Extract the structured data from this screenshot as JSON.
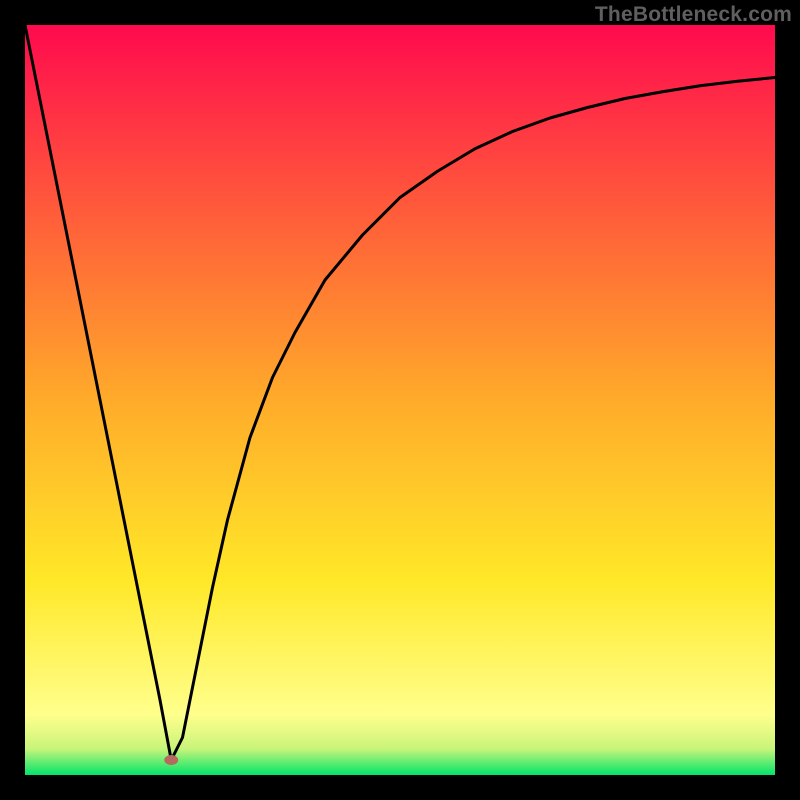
{
  "watermark": "TheBottleneck.com",
  "chart_data": {
    "type": "line",
    "title": "",
    "xlabel": "",
    "ylabel": "",
    "xlim": [
      0,
      100
    ],
    "ylim": [
      0,
      100
    ],
    "x": [
      0,
      2,
      4,
      6,
      8,
      10,
      12,
      14,
      16,
      18,
      19.5,
      21,
      23,
      25,
      27,
      30,
      33,
      36,
      40,
      45,
      50,
      55,
      60,
      65,
      70,
      75,
      80,
      85,
      90,
      95,
      100
    ],
    "values": [
      100,
      90,
      80,
      70,
      60,
      50,
      40,
      30,
      20,
      10,
      2,
      5,
      15,
      25,
      34,
      45,
      53,
      59,
      66,
      72,
      77,
      80.5,
      83.5,
      85.8,
      87.6,
      89,
      90.2,
      91.1,
      91.9,
      92.5,
      93
    ],
    "marker": {
      "x": 19.5,
      "y": 2
    },
    "gradient_stops": [
      {
        "offset": 0.0,
        "color": "#ff0a4e"
      },
      {
        "offset": 0.25,
        "color": "#ff5c3a"
      },
      {
        "offset": 0.5,
        "color": "#ffab2a"
      },
      {
        "offset": 0.74,
        "color": "#ffe828"
      },
      {
        "offset": 0.92,
        "color": "#ffff8c"
      },
      {
        "offset": 0.965,
        "color": "#c9f47a"
      },
      {
        "offset": 1.0,
        "color": "#00e56a"
      }
    ],
    "curve_color": "#000000",
    "marker_color": "#b6695c"
  }
}
